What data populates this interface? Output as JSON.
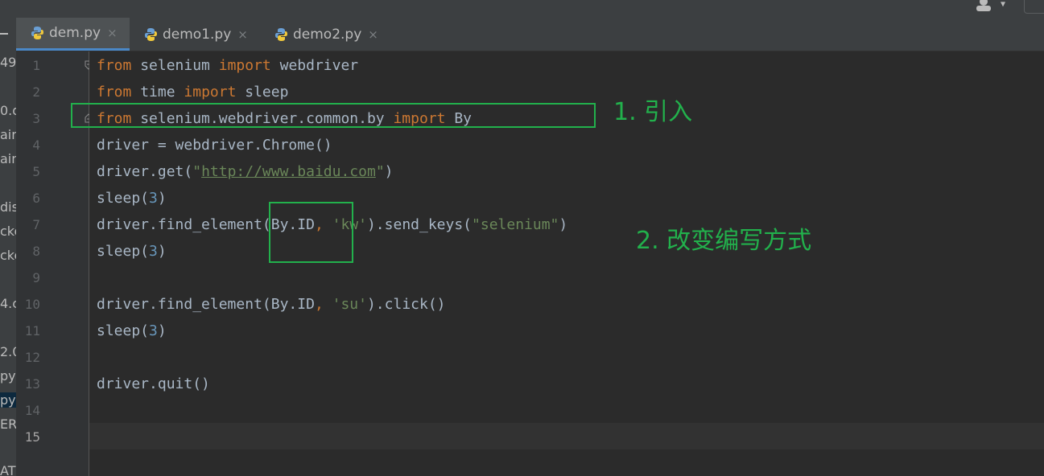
{
  "tabs": [
    {
      "label": "dem.py",
      "active": true
    },
    {
      "label": "demo1.py",
      "active": false
    },
    {
      "label": "demo2.py",
      "active": false
    }
  ],
  "tab_close_glyph": "×",
  "left_fragments": [
    "49",
    "0.d",
    "ain",
    "ain",
    "dis",
    "cke",
    "cke",
    "4.c",
    "2.0",
    "py",
    "py",
    "ER",
    "AT"
  ],
  "line_numbers": [
    "1",
    "2",
    "3",
    "4",
    "5",
    "6",
    "7",
    "8",
    "9",
    "10",
    "11",
    "12",
    "13",
    "14",
    "15"
  ],
  "current_line": "15",
  "code": {
    "l1": {
      "kw1": "from",
      "t1": " selenium ",
      "kw2": "import",
      "t2": " webdriver"
    },
    "l2": {
      "kw1": "from",
      "t1": " time ",
      "kw2": "import",
      "t2": " sleep"
    },
    "l3": {
      "kw1": "from",
      "t1": " selenium.webdriver.common.by ",
      "kw2": "import",
      "t2": " By"
    },
    "l4": {
      "t1": "driver = webdriver.Chrome()"
    },
    "l5": {
      "t1": "driver.get(",
      "q1": "\"",
      "url": "http://www.baidu.com",
      "q2": "\"",
      "t2": ")"
    },
    "l6": {
      "t1": "sleep(",
      "n": "3",
      "t2": ")"
    },
    "l7": {
      "t1": "driver.find_element(By.ID",
      "c": ",",
      "s1": " 'kw'",
      "t2": ").send_keys(",
      "s2": "\"selenium\"",
      "t3": ")"
    },
    "l8": {
      "t1": "sleep(",
      "n": "3",
      "t2": ")"
    },
    "l10": {
      "t1": "driver.find_element(By.ID",
      "c": ",",
      "s1": " 'su'",
      "t2": ").click()"
    },
    "l11": {
      "t1": "sleep(",
      "n": "3",
      "t2": ")"
    },
    "l13": {
      "t1": "driver.quit()"
    }
  },
  "annotations": {
    "note1": "1. 引入",
    "note2": "2. 改变编写方式"
  },
  "colors": {
    "annotation": "#22b14c",
    "keyword": "#cc7832",
    "string": "#6a8759",
    "number": "#6897bb",
    "text": "#a9b7c6"
  }
}
